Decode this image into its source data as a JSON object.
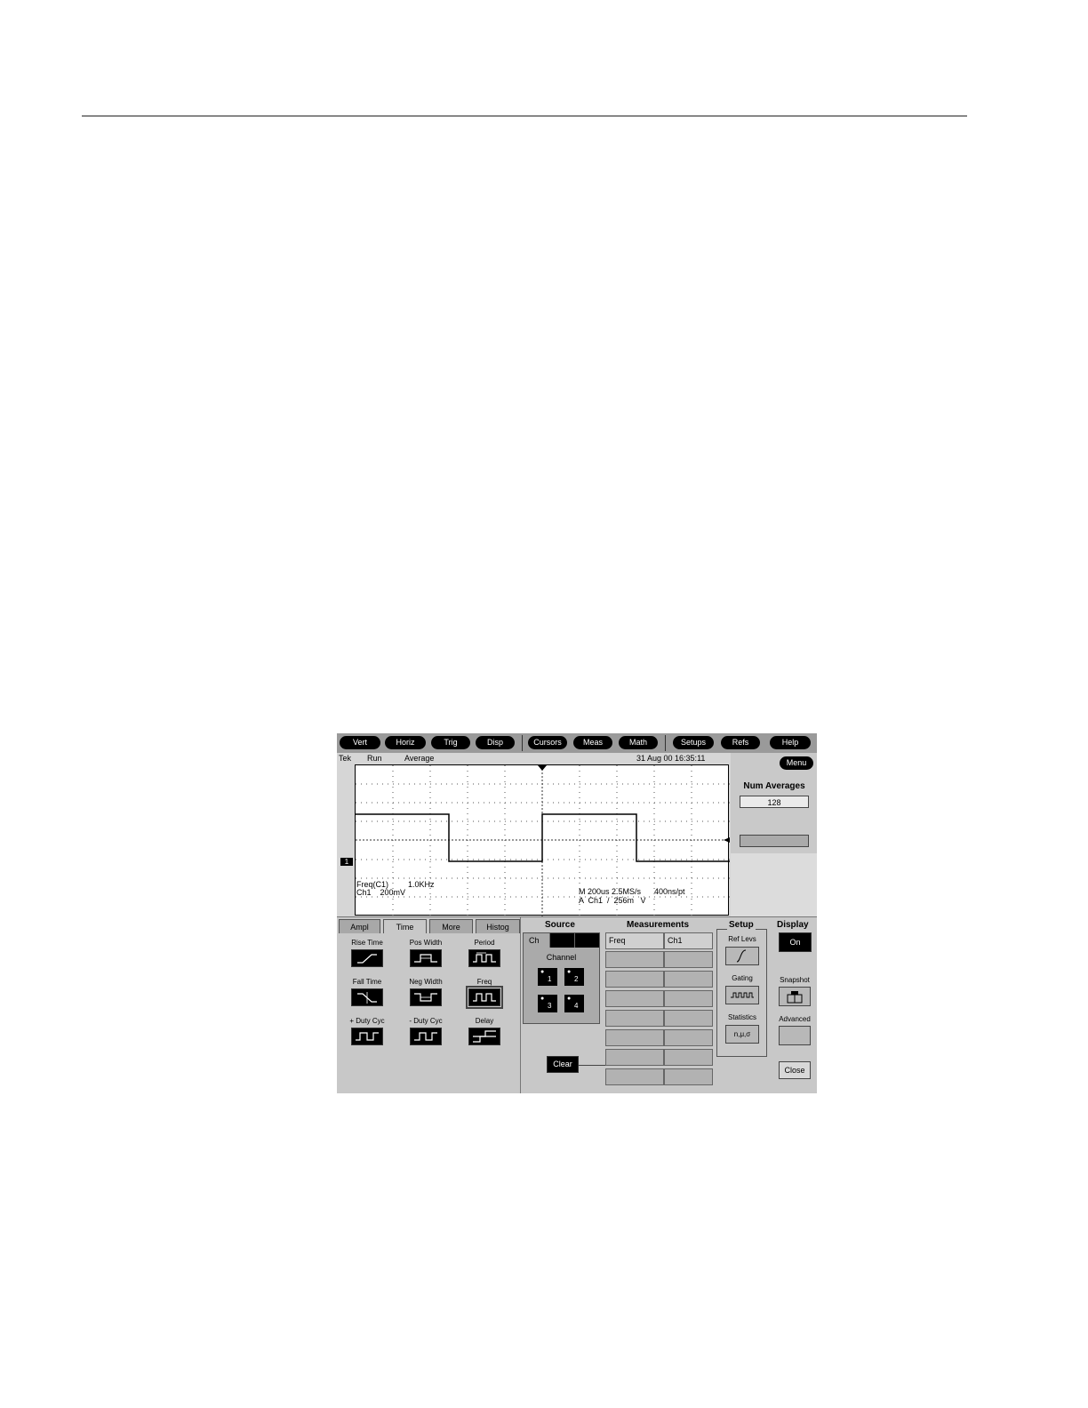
{
  "toolbar": {
    "buttons": [
      "Vert",
      "Horiz",
      "Trig",
      "Disp",
      "Cursors",
      "Meas",
      "Math",
      "Setups",
      "Refs",
      "Help"
    ]
  },
  "status": {
    "brand": "Tek",
    "state": "Run",
    "mode": "Average",
    "datetime": "31 Aug 00 16:35:11"
  },
  "graticule": {
    "channel_marker": "1",
    "readout_left_line1_label": "Freq(C1)",
    "readout_left_line1_value": "1.0KHz",
    "readout_left_line2": "Ch1    200mV",
    "readout_right_line1": "M 200us 2.5MS/s      400ns/pt",
    "readout_right_line2": "A  Ch1  /  256m   V"
  },
  "side_panel": {
    "menu_label": "Menu",
    "num_averages_title": "Num Averages",
    "num_averages_value": "128"
  },
  "tabs": [
    "Ampl",
    "Time",
    "More",
    "Histog"
  ],
  "active_tab": "Time",
  "measurement_types": [
    {
      "label": "Rise Time",
      "icon": "rise-edge-icon"
    },
    {
      "label": "Pos Width",
      "icon": "positive-pulse-icon"
    },
    {
      "label": "Period",
      "icon": "period-icon"
    },
    {
      "label": "Fall Time",
      "icon": "fall-edge-icon"
    },
    {
      "label": "Neg Width",
      "icon": "negative-pulse-icon"
    },
    {
      "label": "Freq",
      "icon": "frequency-icon"
    },
    {
      "label": "+ Duty Cyc",
      "icon": "positive-duty-icon"
    },
    {
      "label": "- Duty Cyc",
      "icon": "negative-duty-icon"
    },
    {
      "label": "Delay",
      "icon": "delay-icon"
    }
  ],
  "selected_measurement": "Freq",
  "source": {
    "title": "Source",
    "tab_label": "Ch",
    "channel_label": "Channel",
    "channels": [
      "1",
      "2",
      "3",
      "4"
    ]
  },
  "measurements": {
    "title": "Measurements",
    "header": [
      "Freq",
      "Ch1"
    ],
    "clear_label": "Clear"
  },
  "setup": {
    "title": "Setup",
    "ref_levs_label": "Ref Levs",
    "gating_label": "Gating",
    "statistics_label": "Statistics",
    "statistics_icon_text": "n,μ,σ"
  },
  "display": {
    "title": "Display",
    "on_label": "On",
    "snapshot_label": "Snapshot",
    "advanced_label": "Advanced",
    "close_label": "Close"
  }
}
